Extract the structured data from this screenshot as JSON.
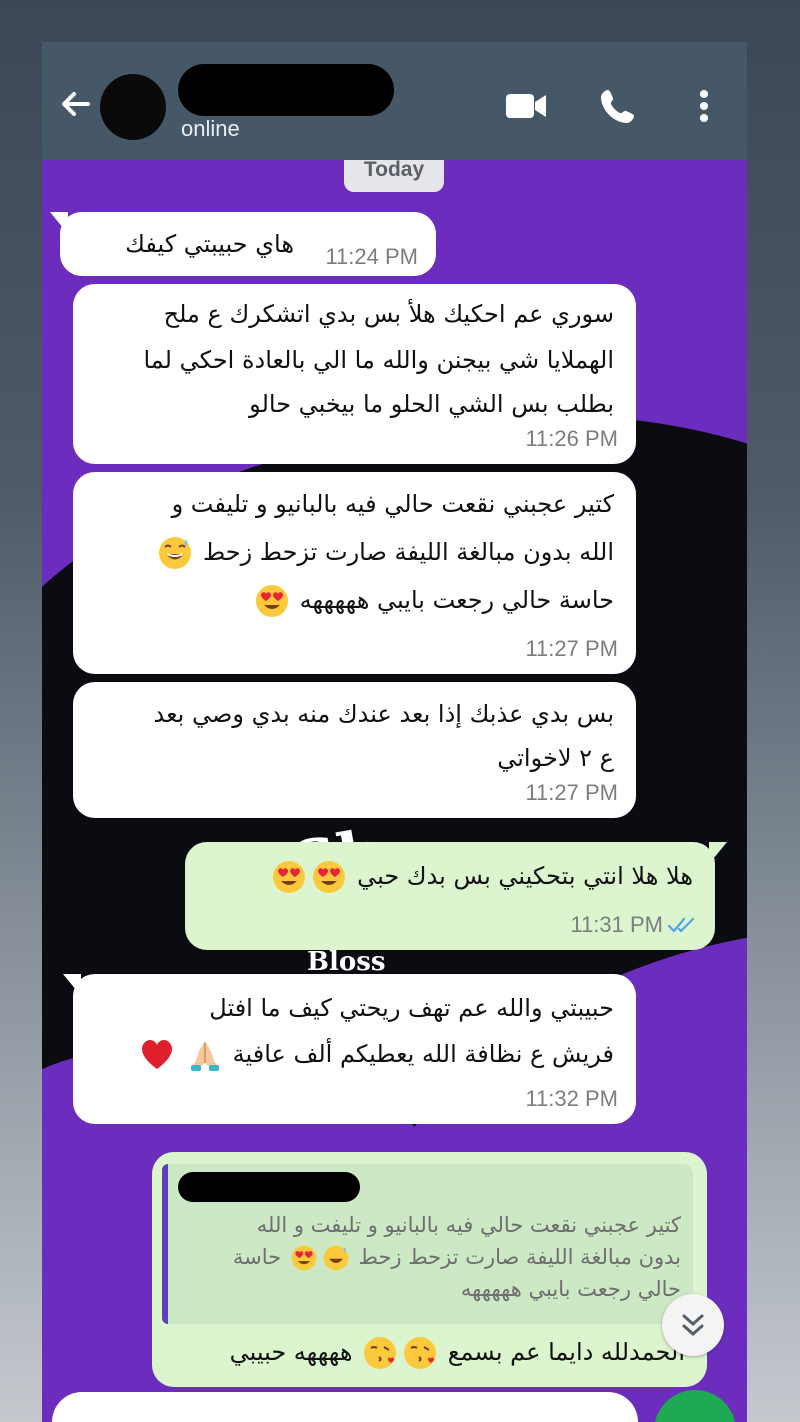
{
  "header": {
    "status": "online"
  },
  "date_chip": "Today",
  "messages": [
    {
      "lines": [
        "هاي حبيبتي كيفك"
      ],
      "time": "11:24 PM"
    },
    {
      "lines": [
        "سوري عم احكيك هلأ بس بدي اتشكرك ع ملح",
        "الهملايا شي بيجنن والله ما الي بالعادة احكي لما",
        "بطلب بس الشي الحلو ما بيخبي حالو"
      ],
      "time": "11:26 PM"
    },
    {
      "lines": [
        "كتير عجبني نقعت حالي فيه بالبانيو و تليفت و",
        "الله بدون مبالغة الليفة صارت تزحط زحط",
        "حاسة حالي رجعت بايبي هههههه"
      ],
      "time": "11:27 PM"
    },
    {
      "lines": [
        "بس بدي عذبك إذا بعد عندك منه بدي وصي بعد",
        "ع ٢ لاخواتي"
      ],
      "time": "11:27 PM"
    },
    {
      "lines": [
        "هلا هلا انتي بتحكيني بس بدك حبي"
      ],
      "time": "11:31 PM"
    },
    {
      "lines": [
        "حبيبتي والله عم تهف ريحتي كيف ما افتل",
        "فريش ع نظافة الله يعطيكم ألف عافية"
      ],
      "time": "11:32 PM"
    },
    {
      "quote_lines": [
        "كتير عجبني نقعت حالي فيه بالبانيو و تليفت و الله",
        "بدون مبالغة الليفة صارت تزحط زحط",
        "حالي رجعت بايبي هههههه"
      ],
      "quote_line2_suffix": "حاسة",
      "reply": [
        "الحمدلله دايما عم بسمع",
        "ههههه حبيبي"
      ]
    }
  ],
  "colors": {
    "header": "#465867",
    "wallpaper": "#6c2dbf",
    "incoming": "#ffffff",
    "outgoing": "#dcf5cf",
    "read_ticks": "#4fa3f0",
    "send_button": "#1ea952"
  }
}
